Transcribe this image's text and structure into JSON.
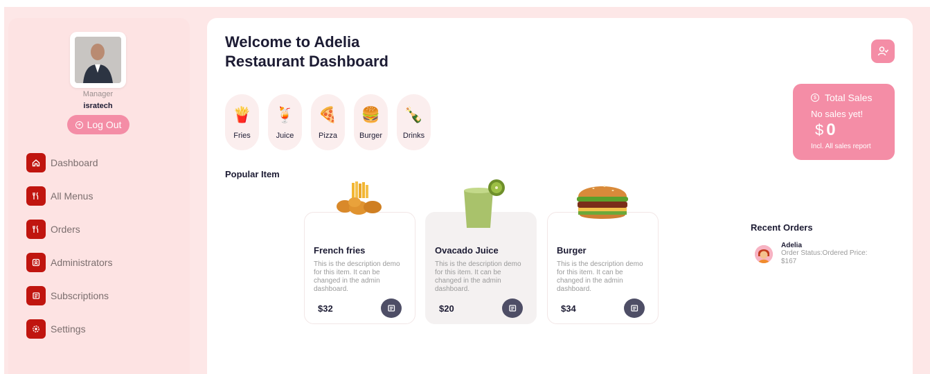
{
  "sidebar": {
    "role": "Manager",
    "username": "isratech",
    "logout_label": "Log Out",
    "items": [
      {
        "label": "Dashboard",
        "icon": "home-icon"
      },
      {
        "label": "All Menus",
        "icon": "utensils-icon"
      },
      {
        "label": "Orders",
        "icon": "utensils-icon"
      },
      {
        "label": "Administrators",
        "icon": "admin-icon"
      },
      {
        "label": "Subscriptions",
        "icon": "newspaper-icon"
      },
      {
        "label": "Settings",
        "icon": "gear-icon"
      }
    ]
  },
  "header": {
    "title_line1": "Welcome to Adelia",
    "title_line2": "Restaurant Dashboard"
  },
  "categories": [
    {
      "label": "Fries",
      "icon": "🍟"
    },
    {
      "label": "Juice",
      "icon": "🍹"
    },
    {
      "label": "Pizza",
      "icon": "🍕"
    },
    {
      "label": "Burger",
      "icon": "🍔"
    },
    {
      "label": "Drinks",
      "icon": "🍾"
    }
  ],
  "sales": {
    "title": "Total Sales",
    "subtitle": "No sales yet!",
    "currency": "$",
    "amount": "0",
    "note": "Incl. All sales report"
  },
  "popular": {
    "title": "Popular Item",
    "items": [
      {
        "name": "French fries",
        "desc": "This is the description demo for this item. It can be changed in the admin dashboard.",
        "price": "$32"
      },
      {
        "name": "Ovacado Juice",
        "desc": "This is the description demo for this item. It can be changed in the admin dashboard.",
        "price": "$20"
      },
      {
        "name": "Burger",
        "desc": "This is the description demo for this item. It can be changed in the admin dashboard.",
        "price": "$34"
      }
    ]
  },
  "recent": {
    "title": "Recent Orders",
    "orders": [
      {
        "name": "Adelia",
        "status": "Order Status:Ordered Price: $167"
      }
    ]
  },
  "colors": {
    "accent_pink": "#f48da6",
    "nav_red": "#c0150f",
    "background": "#fde7e7"
  }
}
